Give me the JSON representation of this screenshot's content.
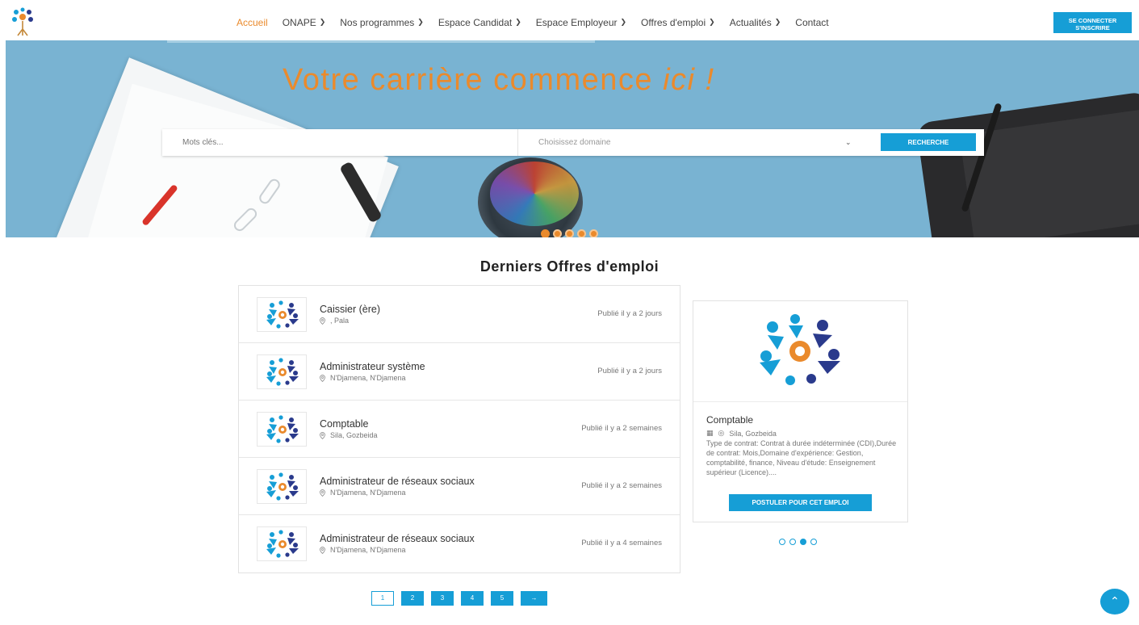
{
  "nav": {
    "items": [
      {
        "label": "Accueil",
        "active": true,
        "dropdown": false
      },
      {
        "label": "ONAPE",
        "active": false,
        "dropdown": true
      },
      {
        "label": "Nos programmes",
        "active": false,
        "dropdown": true
      },
      {
        "label": "Espace Candidat",
        "active": false,
        "dropdown": true
      },
      {
        "label": "Espace Employeur",
        "active": false,
        "dropdown": true
      },
      {
        "label": "Offres d'emploi",
        "active": false,
        "dropdown": true
      },
      {
        "label": "Actualités",
        "active": false,
        "dropdown": true
      },
      {
        "label": "Contact",
        "active": false,
        "dropdown": false
      }
    ],
    "login_label_1": "SE CONNECTER",
    "login_label_2": "S'INSCRIRE",
    "dropdown_icon": "chevron-down-icon"
  },
  "hero": {
    "title_main": "Votre carrière commence",
    "title_em": "ici !",
    "search_placeholder": "Mots clés...",
    "domain_placeholder": "Choisissez domaine",
    "search_button": "RECHERCHE",
    "slides": 5,
    "active_slide": 0
  },
  "section": {
    "title": "Derniers Offres d'emploi"
  },
  "jobs": [
    {
      "title": "Caissier (ère)",
      "location": ", Pala",
      "date": "Publié il y a 2 jours"
    },
    {
      "title": "Administrateur système",
      "location": "N'Djamena, N'Djamena",
      "date": "Publié il y a 2 jours"
    },
    {
      "title": "Comptable",
      "location": "Sila, Gozbeida",
      "date": "Publié il y a 2 semaines"
    },
    {
      "title": "Administrateur de réseaux sociaux",
      "location": "N'Djamena, N'Djamena",
      "date": "Publié il y a 2 semaines"
    },
    {
      "title": "Administrateur de réseaux sociaux",
      "location": "N'Djamena, N'Djamena",
      "date": "Publié il y a 4 semaines"
    }
  ],
  "featured": {
    "title": "Comptable",
    "location": "Sila, Gozbeida",
    "description": "Type de contrat: Contrat à durée indéterminée (CDI),Durée de contrat: Mois,Domaine d'expérience: Gestion, comptabilité, finance, Niveau d'étude: Enseignement supérieur (Licence)....",
    "apply_button": "POSTULER POUR CET EMPLOI",
    "dots": 4,
    "active_dot": 2
  },
  "pagination": {
    "pages": [
      "1",
      "2",
      "3",
      "4",
      "5"
    ],
    "current": "1",
    "next": "→"
  },
  "colors": {
    "accent": "#169ed6",
    "orange": "#ea8a2c",
    "hero_bg": "#79b3d2"
  }
}
